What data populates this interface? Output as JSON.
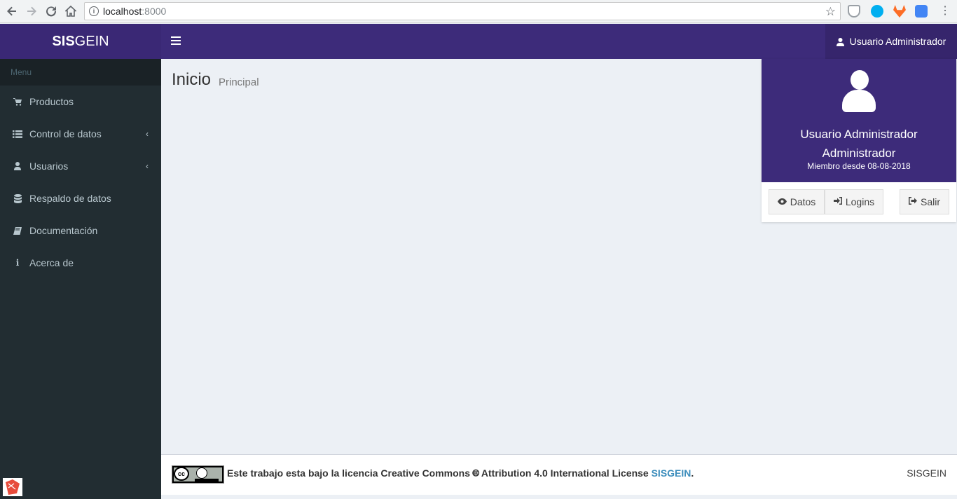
{
  "browser": {
    "url_host": "localhost",
    "url_port": ":8000"
  },
  "app": {
    "logo_bold": "SIS",
    "logo_rest": "GEIN",
    "user_name": "Usuario Administrador"
  },
  "sidebar": {
    "header": "Menu",
    "items": [
      {
        "label": "Productos",
        "icon": "shopping-cart-icon",
        "has_chevron": false
      },
      {
        "label": "Control de datos",
        "icon": "list-icon",
        "has_chevron": true
      },
      {
        "label": "Usuarios",
        "icon": "user-icon",
        "has_chevron": true
      },
      {
        "label": "Respaldo de datos",
        "icon": "database-icon",
        "has_chevron": false
      },
      {
        "label": "Documentación",
        "icon": "book-icon",
        "has_chevron": false
      },
      {
        "label": "Acerca de",
        "icon": "info-icon",
        "has_chevron": false
      }
    ]
  },
  "content": {
    "title": "Inicio",
    "subtitle": "Principal"
  },
  "user_panel": {
    "name_line1": "Usuario Administrador",
    "name_line2": "Administrador",
    "member_since": "Miembro desde 08-08-2018",
    "btn_datos": "Datos",
    "btn_logins": "Logins",
    "btn_salir": "Salir"
  },
  "footer": {
    "cc_label": "cc",
    "license_text": "Este trabajo esta bajo la licencia Creative Commons 🅭 Attribution 4.0 International License ",
    "license_link": "SISGEIN",
    "period": ".",
    "right_text": "SISGEIN"
  },
  "colors": {
    "header": "#3d2b7a",
    "sidebar": "#222d32",
    "content_bg": "#ecf0f5",
    "link": "#3c8dbc"
  }
}
